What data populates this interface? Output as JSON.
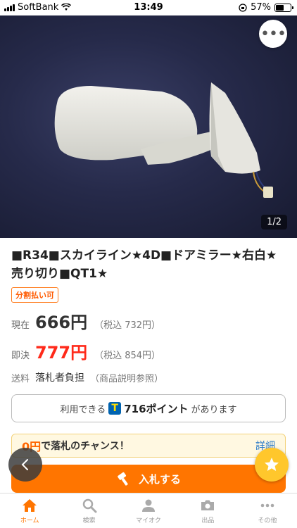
{
  "status": {
    "carrier": "SoftBank",
    "time": "13:49",
    "battery": "57%",
    "battery_level": 0.57
  },
  "gallery": {
    "counter": "1/2",
    "more_label": "•••"
  },
  "item": {
    "title": "■R34■スカイライン★4D■ドアミラー★右白★売り切り■QT1★",
    "installment_badge": "分割払い可",
    "current": {
      "label": "現在",
      "price": "666円",
      "tax": "（税込 732円）"
    },
    "buynow": {
      "label": "即決",
      "price": "777円",
      "tax": "（税込 854円）"
    },
    "shipping": {
      "label": "送料",
      "value": "落札者負担",
      "note": "（商品説明参照）"
    }
  },
  "points": {
    "prefix": "利用できる",
    "t_mark": "T",
    "amount": "716ポイント",
    "suffix": "があります"
  },
  "chance": {
    "zero": "0円",
    "text": "で落札のチャンス！",
    "detail": "詳細"
  },
  "bid_button": {
    "label": "入札する"
  },
  "tabs": [
    {
      "label": "ホーム",
      "icon": "home-icon"
    },
    {
      "label": "検索",
      "icon": "search-icon"
    },
    {
      "label": "マイオク",
      "icon": "person-icon"
    },
    {
      "label": "出品",
      "icon": "camera-icon"
    },
    {
      "label": "その他",
      "icon": "more-dots-icon"
    }
  ],
  "colors": {
    "accent": "#ff7500",
    "buynow_price": "#ff2a1a",
    "link": "#2a7ac8",
    "fav": "#ffc72c"
  }
}
